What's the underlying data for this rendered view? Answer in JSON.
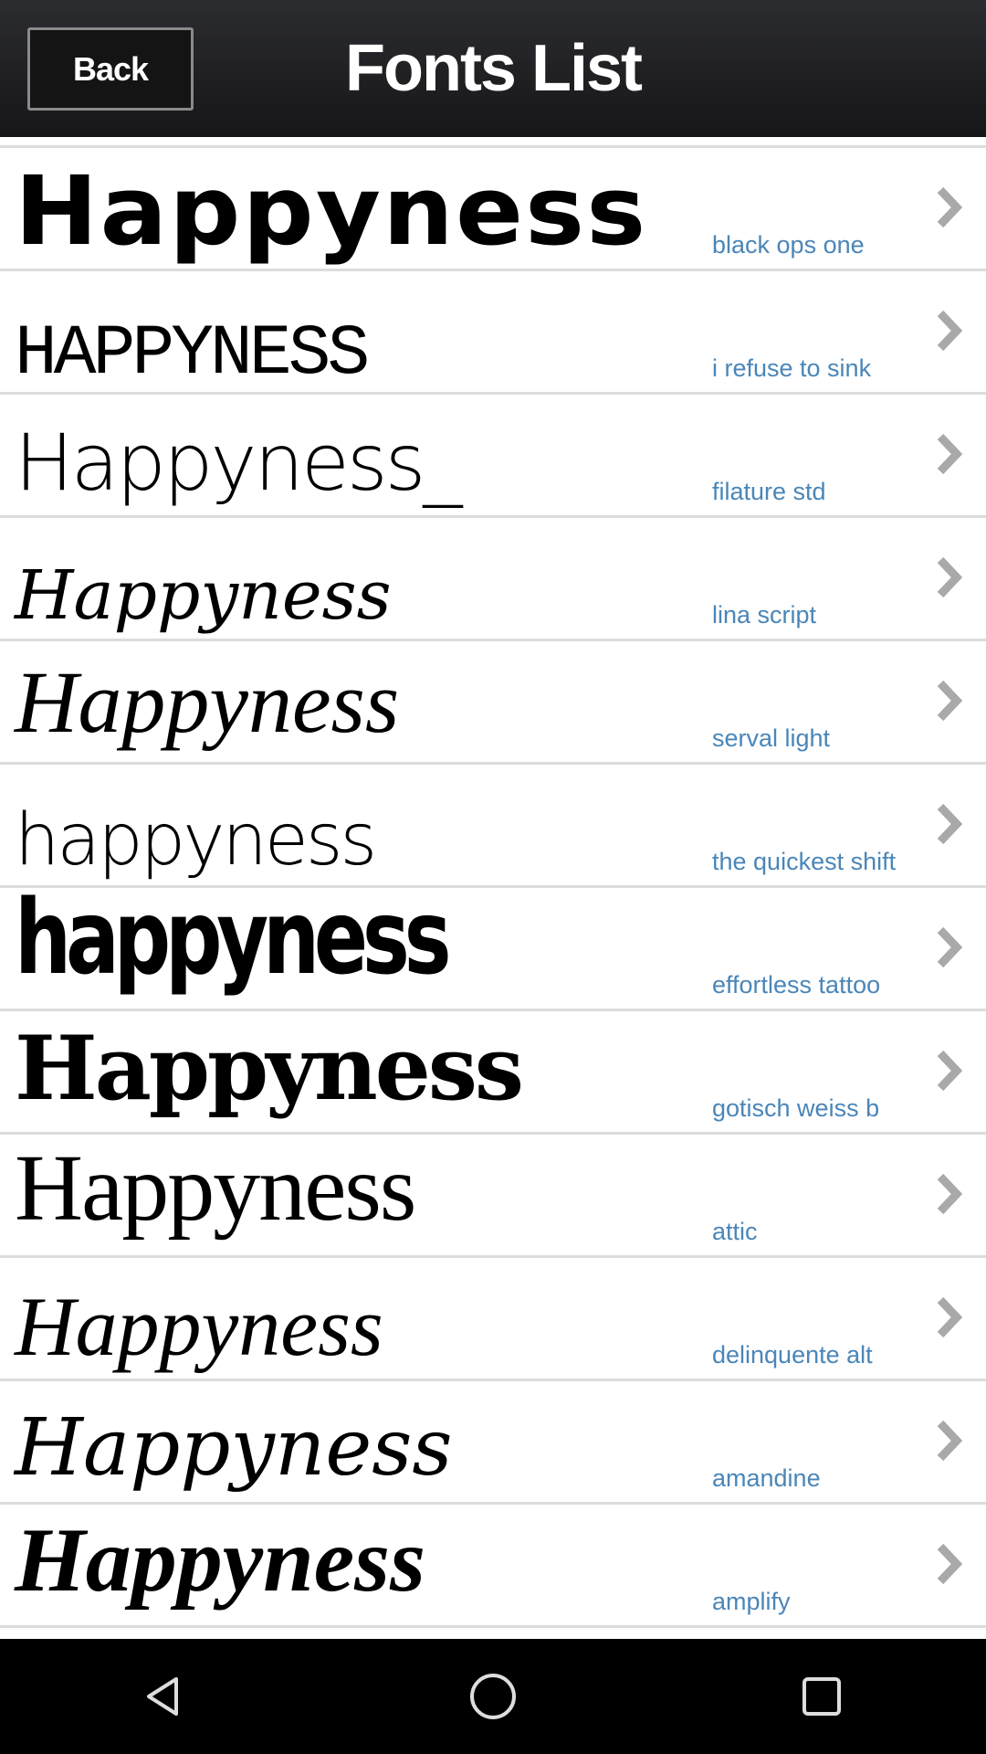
{
  "header": {
    "back_label": "Back",
    "title": "Fonts List"
  },
  "colors": {
    "label": "#4a86b8",
    "chevron": "#a9a9a9",
    "header_bg": "#1f2023"
  },
  "fonts": [
    {
      "sample": "Happyness",
      "name": "black ops one"
    },
    {
      "sample": "HAPPYNESS",
      "name": "i refuse to sink"
    },
    {
      "sample": "Happyness_",
      "name": "filature std"
    },
    {
      "sample": "Happyness",
      "name": "lina script"
    },
    {
      "sample": "Happyness",
      "name": "serval light"
    },
    {
      "sample": "happyness",
      "name": "the quickest shift"
    },
    {
      "sample": "happyness",
      "name": "effortless tattoo"
    },
    {
      "sample": "Happyness",
      "name": "gotisch weiss b"
    },
    {
      "sample": "Happyness",
      "name": "attic"
    },
    {
      "sample": "Happyness",
      "name": "delinquente alt"
    },
    {
      "sample": "Happyness",
      "name": "amandine"
    },
    {
      "sample": "Happyness",
      "name": "amplify"
    }
  ],
  "navbar": {
    "icons": [
      "back-triangle-icon",
      "home-circle-icon",
      "recents-square-icon"
    ]
  }
}
